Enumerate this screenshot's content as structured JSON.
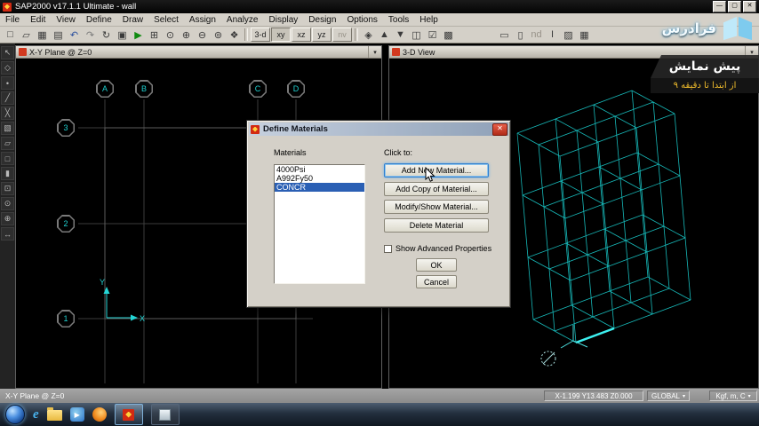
{
  "title_bar": {
    "title": "SAP2000 v17.1.1 Ultimate  - wall",
    "minimize": "—",
    "maximize": "▢",
    "close": "✕"
  },
  "menu_bar": {
    "items": [
      "File",
      "Edit",
      "View",
      "Define",
      "Draw",
      "Select",
      "Assign",
      "Analyze",
      "Display",
      "Design",
      "Options",
      "Tools",
      "Help"
    ]
  },
  "toolbar": {
    "left_icons": [
      {
        "name": "new-model-icon",
        "glyph": "□"
      },
      {
        "name": "open-file-icon",
        "glyph": "▱"
      },
      {
        "name": "save-icon",
        "glyph": "▦"
      },
      {
        "name": "print-icon",
        "glyph": "▤"
      },
      {
        "name": "undo-icon",
        "glyph": "↶",
        "color": "#2a4f9e"
      },
      {
        "name": "redo-icon",
        "glyph": "↷",
        "color": "#7a7a7a"
      },
      {
        "name": "refresh-window-icon",
        "glyph": "↻"
      },
      {
        "name": "lock-model-icon",
        "glyph": "▣"
      },
      {
        "name": "run-analysis-icon",
        "glyph": "▶",
        "color": "#108a10"
      },
      {
        "name": "zoom-window-icon",
        "glyph": "⊞"
      },
      {
        "name": "zoom-full-icon",
        "glyph": "⊙"
      },
      {
        "name": "zoom-in-icon",
        "glyph": "⊕"
      },
      {
        "name": "zoom-out-icon",
        "glyph": "⊖"
      },
      {
        "name": "zoom-previous-icon",
        "glyph": "⊚"
      },
      {
        "name": "pan-icon",
        "glyph": "❖"
      }
    ],
    "view_buttons": [
      {
        "name": "view-3d-button",
        "label": "3-d"
      },
      {
        "name": "view-xy-button",
        "label": "xy",
        "pressed": true
      },
      {
        "name": "view-xz-button",
        "label": "xz"
      },
      {
        "name": "view-yz-button",
        "label": "yz"
      },
      {
        "name": "view-nv-button",
        "label": "nv",
        "grayed": true
      }
    ],
    "right_icons": [
      {
        "name": "perspective-icon",
        "glyph": "◈"
      },
      {
        "name": "move-up-gridline-icon",
        "glyph": "▲"
      },
      {
        "name": "move-down-gridline-icon",
        "glyph": "▼"
      },
      {
        "name": "object-display-icon",
        "glyph": "◫"
      },
      {
        "name": "display-options-icon",
        "glyph": "☑"
      },
      {
        "name": "assign-display-icon",
        "glyph": "▩"
      }
    ],
    "far_icons": [
      {
        "name": "draw-rect-icon",
        "glyph": "▭"
      },
      {
        "name": "draw-window-icon",
        "glyph": "▯"
      },
      {
        "name": "nd-button",
        "label": "nd",
        "grayed": true
      },
      {
        "name": "section-designer-icon",
        "glyph": "I"
      },
      {
        "name": "hatch-icon",
        "glyph": "▨"
      },
      {
        "name": "grid-options-icon",
        "glyph": "▦"
      }
    ]
  },
  "side_toolbar": {
    "icons": [
      {
        "name": "pointer-select-icon",
        "glyph": "↖"
      },
      {
        "name": "reshape-icon",
        "glyph": "◇"
      },
      {
        "name": "draw-joint-icon",
        "glyph": "•"
      },
      {
        "name": "draw-frame-icon",
        "glyph": "╱"
      },
      {
        "name": "quick-draw-frame-icon",
        "glyph": "╳"
      },
      {
        "name": "quick-draw-brace-icon",
        "glyph": "▧"
      },
      {
        "name": "draw-area-icon",
        "glyph": "▱"
      },
      {
        "name": "quick-draw-area-icon",
        "glyph": "□"
      },
      {
        "name": "draw-solid-icon",
        "glyph": "▮"
      },
      {
        "name": "select-window-icon",
        "glyph": "⊡"
      },
      {
        "name": "snap-joints-icon",
        "glyph": "⊙"
      },
      {
        "name": "snap-midpoints-icon",
        "glyph": "⊕"
      },
      {
        "name": "measure-line-icon",
        "glyph": "↔"
      }
    ]
  },
  "plan_window": {
    "title": "X-Y Plane @ Z=0",
    "column_labels": [
      "A",
      "B",
      "C",
      "D"
    ],
    "row_labels": [
      "3",
      "2",
      "1"
    ],
    "axis_labels": {
      "x": "X",
      "y": "Y"
    }
  },
  "three_d_window": {
    "title": "3-D View"
  },
  "glyphs": {
    "dropdown": "▾"
  },
  "dialog": {
    "title": "Define Materials",
    "materials_label": "Materials",
    "click_to_label": "Click to:",
    "materials": [
      {
        "label": "4000Psi"
      },
      {
        "label": "A992Fy50"
      },
      {
        "label": "CONCR",
        "selected": true
      }
    ],
    "buttons": [
      {
        "name": "add-new-material-button",
        "label": "Add New Material...",
        "focused": true
      },
      {
        "name": "add-copy-material-button",
        "label": "Add Copy of Material..."
      },
      {
        "name": "modify-show-material-button",
        "label": "Modify/Show Material..."
      },
      {
        "name": "delete-material-button",
        "label": "Delete Material"
      }
    ],
    "advanced_checkbox_label": "Show Advanced Properties",
    "ok_label": "OK",
    "cancel_label": "Cancel"
  },
  "status_bar": {
    "view_label": "X-Y Plane @ Z=0",
    "coordinates": "X-1.199 Y13.483 Z0.000",
    "csys": "GLOBAL",
    "units": "Kgf, m, C"
  },
  "taskbar": {
    "ie_letter": "e",
    "play_glyph": "▶"
  },
  "watermark": {
    "brand": "فرادرس",
    "preview_title": "پیش نمایش",
    "preview_subtitle": "از ابتدا تا دقیقه ۹"
  }
}
